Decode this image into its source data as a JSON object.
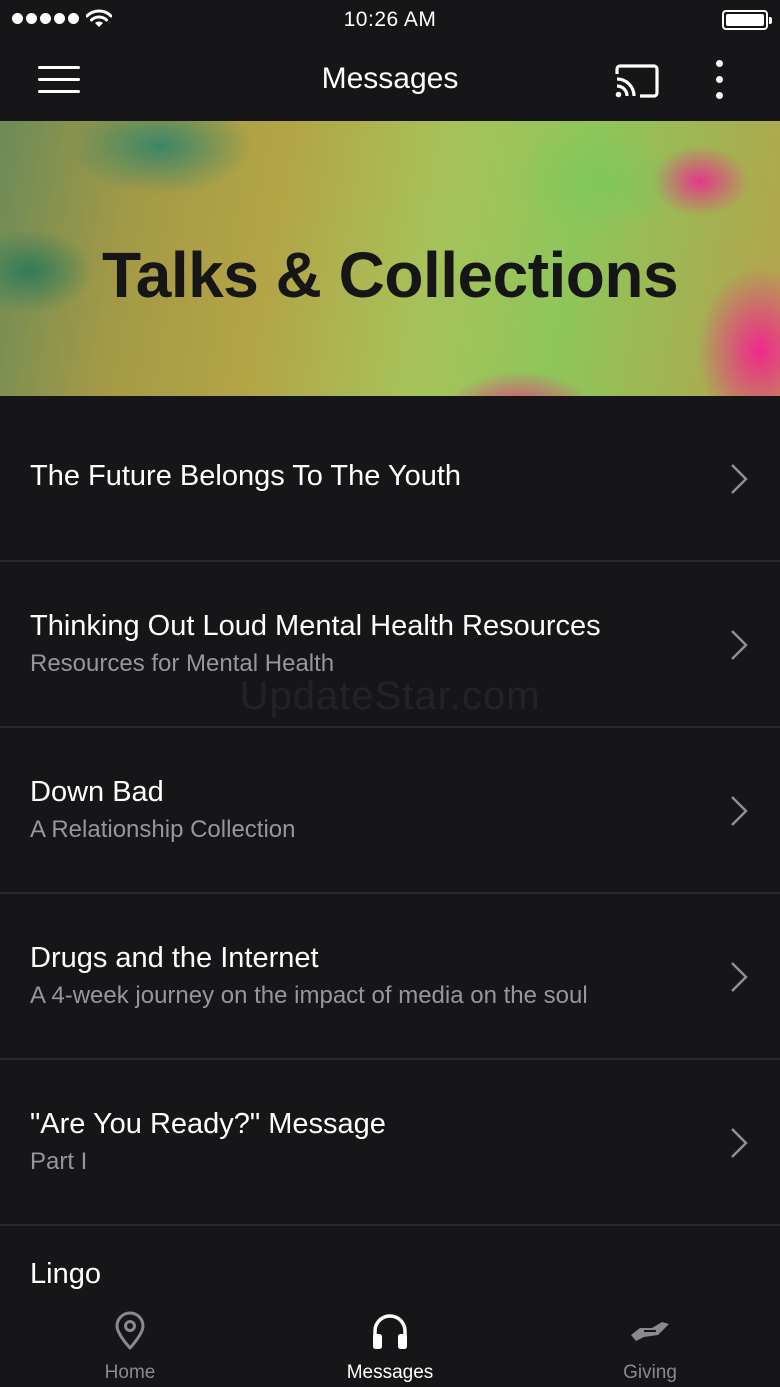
{
  "status_bar": {
    "time": "10:26 AM"
  },
  "header": {
    "title": "Messages"
  },
  "banner": {
    "title": "Talks & Collections"
  },
  "items": [
    {
      "title": "The Future Belongs To The Youth",
      "subtitle": ""
    },
    {
      "title": "Thinking Out Loud Mental Health Resources",
      "subtitle": "Resources for Mental Health"
    },
    {
      "title": "Down Bad",
      "subtitle": "A Relationship Collection"
    },
    {
      "title": "Drugs and the Internet",
      "subtitle": "A 4-week journey on the impact of media on the soul"
    },
    {
      "title": "\"Are You Ready?\" Message",
      "subtitle": "Part I"
    },
    {
      "title": "Lingo",
      "subtitle": ""
    }
  ],
  "watermark": "UpdateStar.com",
  "tabs": [
    {
      "label": "Home",
      "icon": "map-pin-icon",
      "active": false
    },
    {
      "label": "Messages",
      "icon": "headphones-icon",
      "active": true
    },
    {
      "label": "Giving",
      "icon": "giving-hand-icon",
      "active": false
    }
  ],
  "colors": {
    "background": "#161618",
    "divider": "#2a2a2d",
    "subtitle": "#97979b",
    "tab_inactive": "#8a8a8e"
  }
}
